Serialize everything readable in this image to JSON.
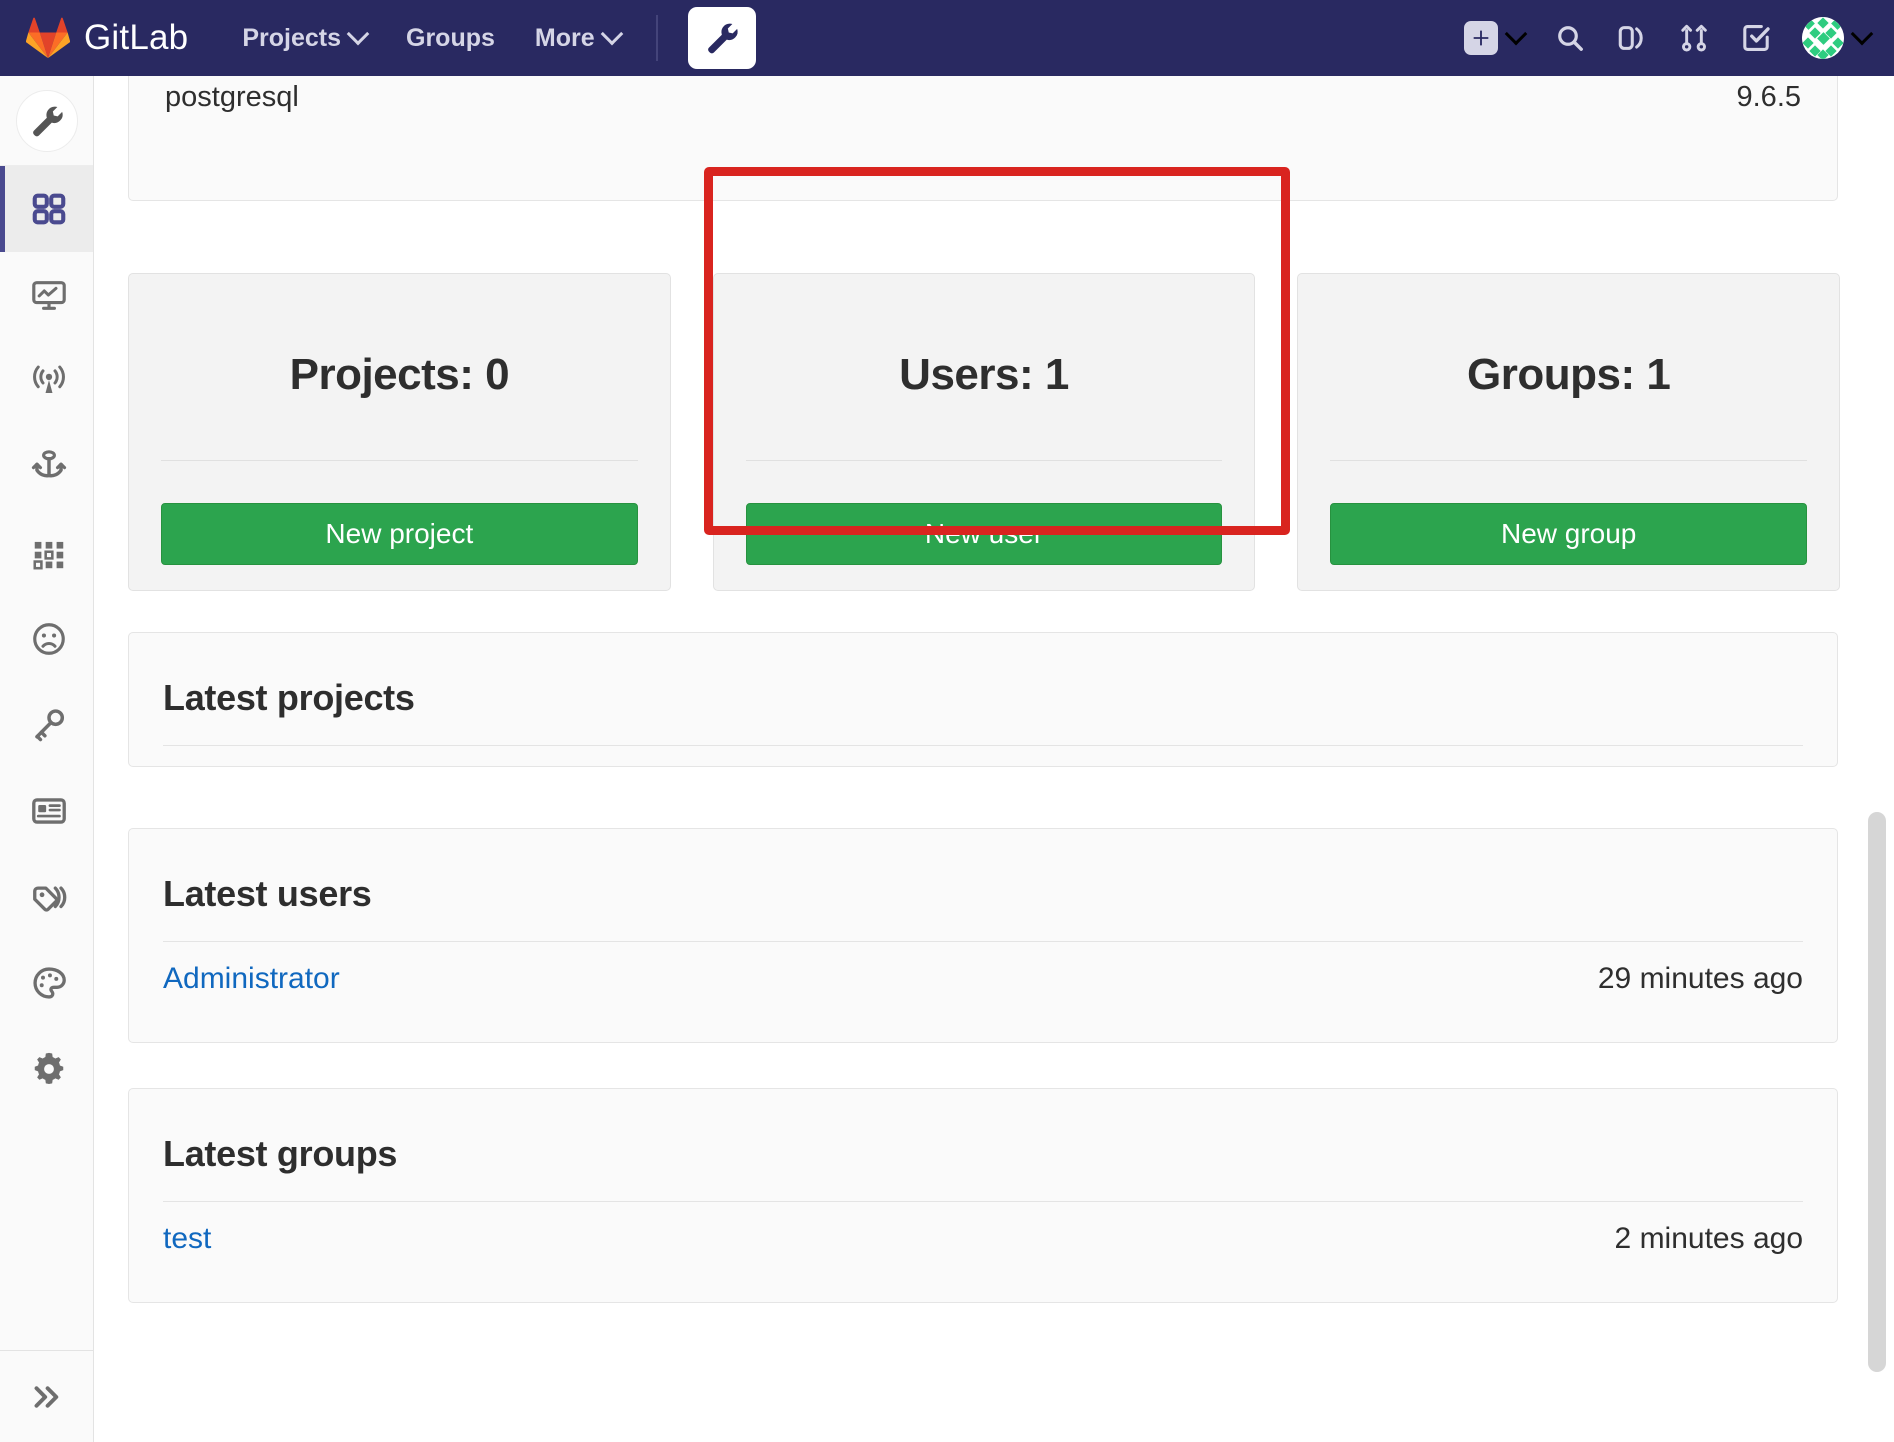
{
  "navbar": {
    "brand": "GitLab",
    "brand_logo_icon": "gitlab-tanuki-logo",
    "links": [
      {
        "label": "Projects",
        "has_chevron": true
      },
      {
        "label": "Groups",
        "has_chevron": false
      },
      {
        "label": "More",
        "has_chevron": true
      }
    ],
    "admin_tab_icon": "wrench-icon",
    "right_icons": [
      {
        "name": "plus-icon",
        "chevron": true
      },
      {
        "name": "search-icon",
        "chevron": false
      },
      {
        "name": "issues-icon",
        "chevron": false
      },
      {
        "name": "merge-requests-icon",
        "chevron": false
      },
      {
        "name": "todos-icon",
        "chevron": false
      },
      {
        "name": "avatar",
        "chevron": true
      }
    ]
  },
  "sidebar": {
    "header_icon": "wrench-icon",
    "items": [
      {
        "icon": "overview-grid-icon",
        "label": "Overview",
        "active": true
      },
      {
        "icon": "monitoring-icon",
        "label": "Monitoring",
        "active": false
      },
      {
        "icon": "broadcast-messages-icon",
        "label": "Messages",
        "active": false
      },
      {
        "icon": "system-hooks-anchor-icon",
        "label": "System Hooks",
        "active": false
      },
      {
        "icon": "applications-icon",
        "label": "Applications",
        "active": false
      },
      {
        "icon": "abuse-reports-icon",
        "label": "Abuse Reports",
        "active": false
      },
      {
        "icon": "deploy-keys-icon",
        "label": "Deploy Keys",
        "active": false
      },
      {
        "icon": "license-icon",
        "label": "License",
        "active": false
      },
      {
        "icon": "labels-icon",
        "label": "Labels",
        "active": false
      },
      {
        "icon": "appearance-palette-icon",
        "label": "Appearance",
        "active": false
      },
      {
        "icon": "settings-gear-icon",
        "label": "Settings",
        "active": false
      }
    ],
    "collapse_icon": "double-chevron-right-icon"
  },
  "info_card": {
    "key": "postgresql",
    "value": "9.6.5"
  },
  "stats": [
    {
      "title": "Projects: 0",
      "button_label": "New project",
      "highlighted": false
    },
    {
      "title": "Users: 1",
      "button_label": "New user",
      "highlighted": true
    },
    {
      "title": "Groups: 1",
      "button_label": "New group",
      "highlighted": false
    }
  ],
  "sections": {
    "latest_projects": {
      "title": "Latest projects",
      "rows": []
    },
    "latest_users": {
      "title": "Latest users",
      "rows": [
        {
          "name": "Administrator",
          "time": "29 minutes ago"
        }
      ]
    },
    "latest_groups": {
      "title": "Latest groups",
      "rows": [
        {
          "name": "test",
          "time": "2 minutes ago"
        }
      ]
    }
  },
  "colors": {
    "navbar": "#292961",
    "primary_green": "#2ca44e",
    "link_blue": "#1068bf",
    "annotation_red": "#d9241f",
    "sidebar_active": "#4a4a8f"
  }
}
